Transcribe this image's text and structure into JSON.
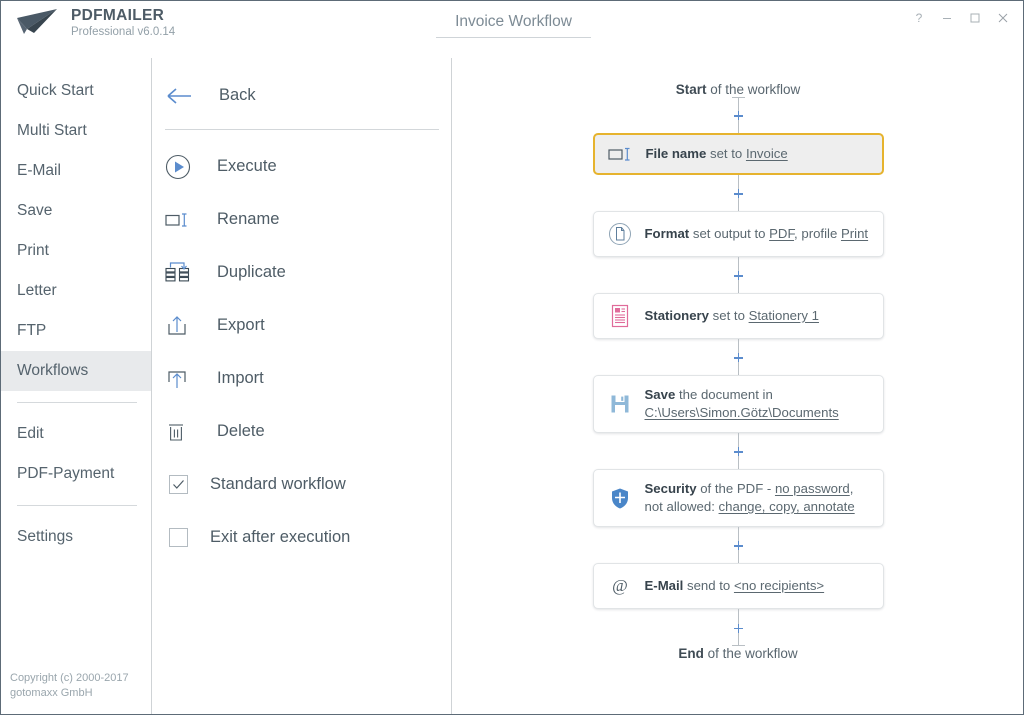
{
  "window": {
    "brand_name": "PDFMAILER",
    "brand_sub": "Professional v6.0.14",
    "document_title": "Invoice Workflow",
    "controls": [
      {
        "name": "help-button",
        "label": "?"
      },
      {
        "name": "minimize-button",
        "label": ""
      },
      {
        "name": "maximize-button",
        "label": ""
      },
      {
        "name": "close-button",
        "label": ""
      }
    ]
  },
  "sidebar": {
    "items": [
      {
        "label": "Quick Start",
        "active": false
      },
      {
        "label": "Multi Start",
        "active": false
      },
      {
        "label": "E-Mail",
        "active": false
      },
      {
        "label": "Save",
        "active": false
      },
      {
        "label": "Print",
        "active": false
      },
      {
        "label": "Letter",
        "active": false
      },
      {
        "label": "FTP",
        "active": false
      },
      {
        "label": "Workflows",
        "active": true
      }
    ],
    "group2": [
      {
        "label": "Edit"
      },
      {
        "label": "PDF-Payment"
      }
    ],
    "group3": [
      {
        "label": "Settings"
      }
    ],
    "copyright_line1": "Copyright (c) 2000-2017",
    "copyright_line2": "gotomaxx GmbH"
  },
  "midpanel": {
    "back_label": "Back",
    "menu": [
      {
        "label": "Execute",
        "icon": "play-circle-icon"
      },
      {
        "label": "Rename",
        "icon": "rename-icon"
      },
      {
        "label": "Duplicate",
        "icon": "duplicate-icon"
      },
      {
        "label": "Export",
        "icon": "export-icon"
      },
      {
        "label": "Import",
        "icon": "import-icon"
      },
      {
        "label": "Delete",
        "icon": "trash-icon"
      }
    ],
    "checkboxes": [
      {
        "label": "Standard workflow",
        "checked": true
      },
      {
        "label": "Exit after execution",
        "checked": false
      }
    ]
  },
  "workflow": {
    "start_bold": "Start",
    "start_rest": " of the workflow",
    "end_bold": "End",
    "end_rest": " of the workflow",
    "steps": [
      {
        "icon": "rename-icon",
        "title": "File name",
        "selected": true,
        "parts": [
          {
            "t": " set to ",
            "style": "plain"
          },
          {
            "t": "Invoice",
            "style": "link"
          }
        ]
      },
      {
        "icon": "format-document-icon",
        "title": "Format",
        "selected": false,
        "parts": [
          {
            "t": " set output to ",
            "style": "plain"
          },
          {
            "t": "PDF",
            "style": "link"
          },
          {
            "t": ", profile ",
            "style": "plain"
          },
          {
            "t": "Print",
            "style": "link"
          }
        ]
      },
      {
        "icon": "stationery-icon",
        "title": "Stationery",
        "selected": false,
        "parts": [
          {
            "t": " set to ",
            "style": "plain"
          },
          {
            "t": "Stationery 1",
            "style": "link"
          }
        ]
      },
      {
        "icon": "save-floppy-icon",
        "title": "Save",
        "selected": false,
        "parts": [
          {
            "t": " the document in ",
            "style": "plain"
          },
          {
            "t": "C:\\Users\\Simon.Götz\\Documents",
            "style": "link"
          }
        ]
      },
      {
        "icon": "shield-icon",
        "title": "Security",
        "selected": false,
        "parts": [
          {
            "t": " of the PDF - ",
            "style": "plain"
          },
          {
            "t": "no password",
            "style": "link"
          },
          {
            "t": ", not allowed: ",
            "style": "plain"
          },
          {
            "t": "change, copy, annotate",
            "style": "link"
          }
        ]
      },
      {
        "icon": "at-sign-icon",
        "title": "E-Mail",
        "selected": false,
        "parts": [
          {
            "t": " send to ",
            "style": "plain"
          },
          {
            "t": "<no recipients>",
            "style": "link"
          }
        ]
      }
    ]
  },
  "colors": {
    "accent_blue": "#5b8ccd",
    "selected_border": "#e6b32e",
    "text_dark": "#37434c",
    "text_muted": "#7d8b95",
    "stationery_pink": "#e06b9a",
    "save_blue": "#8fb8d8"
  }
}
